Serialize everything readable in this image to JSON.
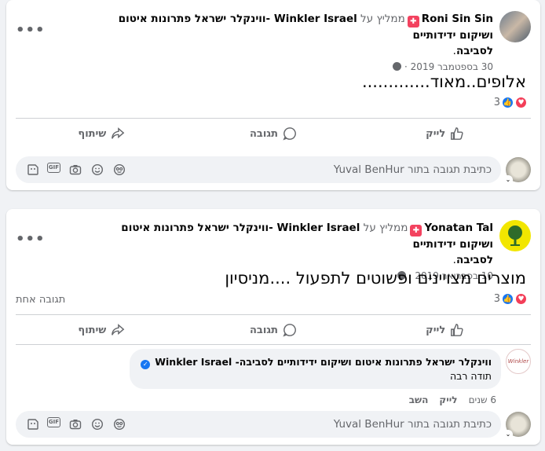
{
  "posts": [
    {
      "author": "Roni Sin Sin",
      "recommends_text": "ממליץ על",
      "page_line1": "Winkler Israel -ווינקלר ישראל פתרונות איטום ושיקום ידידותיים",
      "page_line2": "לסביבה",
      "date": "30 בספטמבר 2019",
      "separator": "·",
      "text": "אלופים..מאוד.............",
      "reaction_count": "3",
      "comments_count": "",
      "actions": {
        "like": "לייק",
        "comment": "תגובה",
        "share": "שיתוף"
      },
      "composer_placeholder": "כתיבת תגובה בתור Yuval BenHur"
    },
    {
      "author": "Yonatan Tal",
      "recommends_text": "ממליץ על",
      "page_line1": "Winkler Israel -ווינקלר ישראל פתרונות איטום ושיקום ידידותיים",
      "page_line2": "לסביבה",
      "date": "10 בפברואר 2019",
      "separator": "·",
      "text": "מוצרים מצויינים ופשוטים לתפעול ....מניסיון",
      "reaction_count": "3",
      "comments_count": "תגובה אחת",
      "actions": {
        "like": "לייק",
        "comment": "תגובה",
        "share": "שיתוף"
      },
      "reply": {
        "avatar_text": "Winkler",
        "author": "ווינקלר ישראל פתרונות איטום ושיקום ידידותיים לסביבה- Winkler Israel",
        "text": "תודה רבה",
        "time": "6 שנים",
        "like": "לייק",
        "reply": "השב"
      },
      "composer_placeholder": "כתיבת תגובה בתור Yuval BenHur"
    }
  ],
  "icons": {
    "reactions": [
      "like-icon",
      "love-icon"
    ],
    "composer": [
      "sticker-icon",
      "gif-icon",
      "camera-icon",
      "emoji-icon",
      "avatar-sticker-icon"
    ],
    "gif_label": "GIF"
  },
  "colors": {
    "like_blue": "#1877f2",
    "love_red": "#f33e58",
    "recommend_pink": "#f3425f",
    "muted": "#65676b"
  }
}
